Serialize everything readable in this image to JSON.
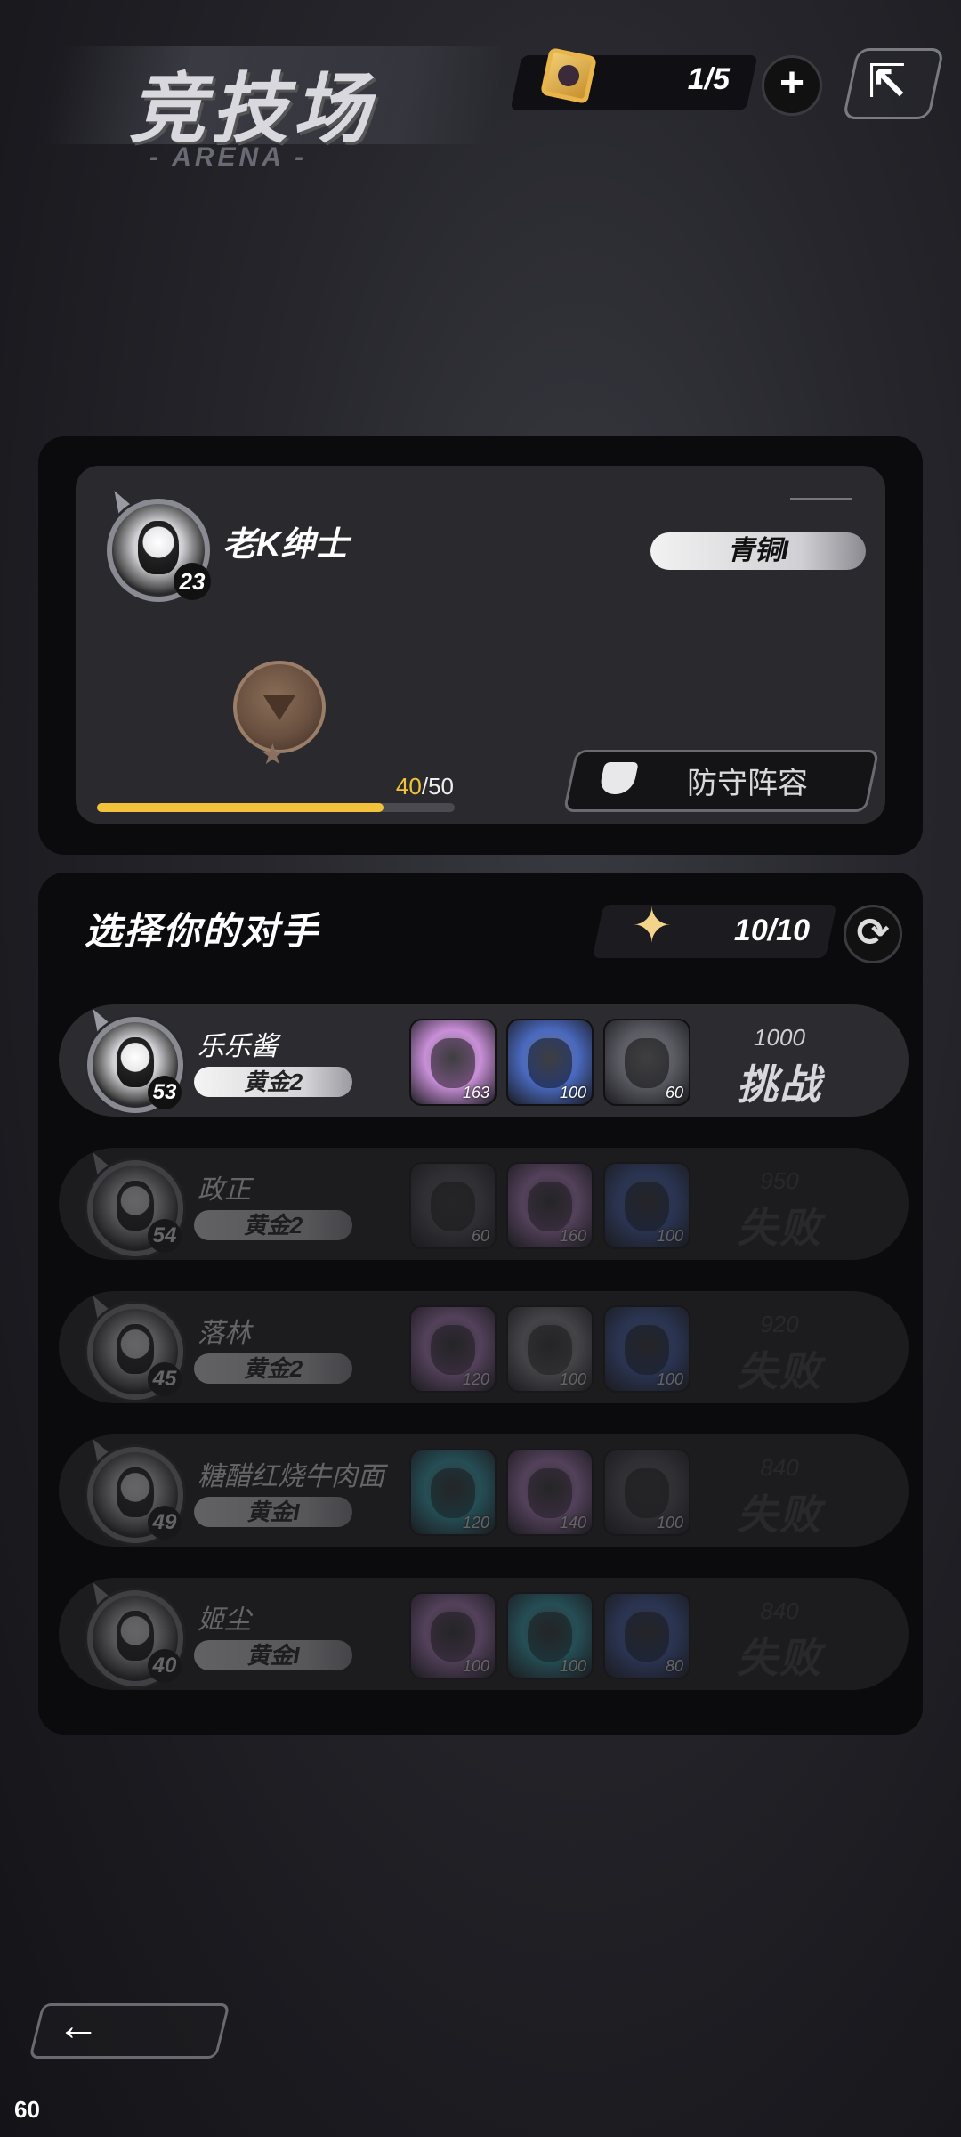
{
  "header": {
    "title": "竞技场",
    "subtitle": "- ARENA -",
    "currency_value": "1/5",
    "plus_glyph": "+",
    "exit_glyph": "⇱"
  },
  "player": {
    "name": "老K绅士",
    "level": "23",
    "rank": "青铜I",
    "xp_current": "40",
    "xp_max": "50",
    "xp_fraction": 0.8,
    "defense_label": "防守阵容"
  },
  "opponents_section": {
    "title": "选择你的对手",
    "tickets": "10/10",
    "refresh_glyph": "⟳"
  },
  "opponents": [
    {
      "name": "乐乐酱",
      "level": "53",
      "rank": "黄金2",
      "score": "1000",
      "action": "挑战",
      "heroes": [
        {
          "level": "163",
          "color": "#c98fd8"
        },
        {
          "level": "100",
          "color": "#4a6ac0"
        },
        {
          "level": "60",
          "color": "#5a5a62"
        }
      ]
    },
    {
      "name": "政正",
      "level": "54",
      "rank": "黄金2",
      "score": "950",
      "action": "失败",
      "heroes": [
        {
          "level": "60",
          "color": "#5a5a62"
        },
        {
          "level": "160",
          "color": "#c98fd8"
        },
        {
          "level": "100",
          "color": "#4a6ac0"
        }
      ]
    },
    {
      "name": "落林",
      "level": "45",
      "rank": "黄金2",
      "score": "920",
      "action": "失败",
      "heroes": [
        {
          "level": "120",
          "color": "#c98fd8"
        },
        {
          "level": "100",
          "color": "#9a9aa0"
        },
        {
          "level": "100",
          "color": "#4a6ac0"
        }
      ]
    },
    {
      "name": "糖醋红烧牛肉面",
      "level": "49",
      "rank": "黄金I",
      "score": "840",
      "action": "失败",
      "heroes": [
        {
          "level": "120",
          "color": "#3ab8c8"
        },
        {
          "level": "140",
          "color": "#c98fd8"
        },
        {
          "level": "100",
          "color": "#5a5a62"
        }
      ]
    },
    {
      "name": "姬尘",
      "level": "40",
      "rank": "黄金I",
      "score": "840",
      "action": "失败",
      "heroes": [
        {
          "level": "100",
          "color": "#c98fd8"
        },
        {
          "level": "100",
          "color": "#3ab8c8"
        },
        {
          "level": "80",
          "color": "#4a6ac0"
        }
      ]
    }
  ],
  "footer": {
    "back_glyph": "←",
    "fps": "60"
  },
  "colors": {
    "xp_fill": "#f2c23a",
    "panel": "#0b0b0d"
  }
}
